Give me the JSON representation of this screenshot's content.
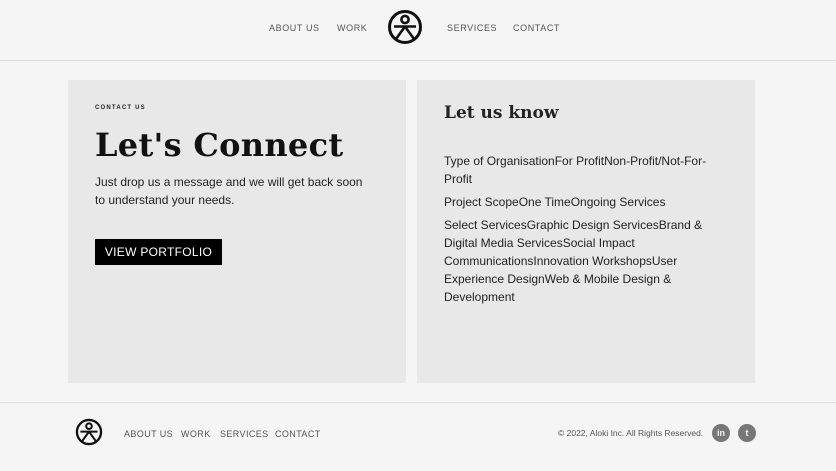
{
  "nav": {
    "items": [
      {
        "label": "ABOUT US"
      },
      {
        "label": "WORK"
      },
      {
        "label": "SERVICES"
      },
      {
        "label": "CONTACT"
      }
    ]
  },
  "hero": {
    "eyebrow": "CONTACT US",
    "title": "Let's Connect",
    "text": "Just drop us a message and we will get back soon to understand your needs.",
    "button_label": "VIEW PORTFOLIO"
  },
  "form": {
    "title": "Let us know",
    "fields": [
      {
        "text": "Type of OrganisationFor ProfitNon-Profit/Not-For-Profit"
      },
      {
        "text": "Project ScopeOne TimeOngoing Services"
      },
      {
        "text": "Select ServicesGraphic Design ServicesBrand & Digital Media ServicesSocial Impact CommunicationsInnovation WorkshopsUser Experience DesignWeb & Mobile Design & Development"
      }
    ]
  },
  "footer": {
    "links": [
      {
        "label": "ABOUT US"
      },
      {
        "label": "WORK"
      },
      {
        "label": "SERVICES"
      },
      {
        "label": "CONTACT"
      }
    ],
    "copyright": "© 2022, Aloki Inc. All Rights Reserved.",
    "social": [
      {
        "icon": "linkedin-icon",
        "glyph": "in"
      },
      {
        "icon": "twitter-icon",
        "glyph": "t"
      }
    ]
  }
}
